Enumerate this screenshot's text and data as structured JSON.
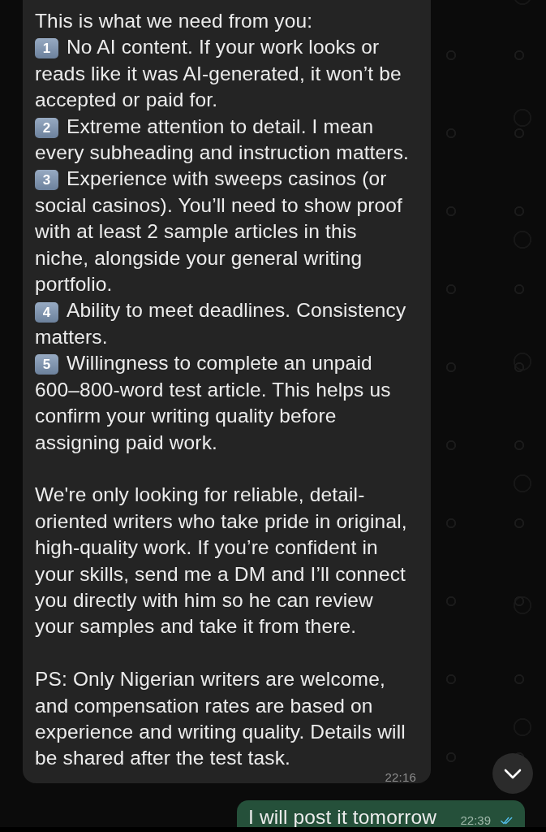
{
  "incoming_message": {
    "intro": "This is what we need from you:",
    "points": [
      {
        "number": "1",
        "lines": [
          "No AI content. If your work looks or",
          "reads like it was AI-generated, it won’t be",
          "accepted or paid for."
        ]
      },
      {
        "number": "2",
        "lines": [
          "Extreme attention to detail. I mean",
          "every subheading and instruction matters."
        ]
      },
      {
        "number": "3",
        "lines": [
          "Experience with sweeps casinos (or",
          "social casinos). You’ll need to show proof",
          "with at least 2 sample articles in this",
          "niche, alongside your general writing",
          "portfolio."
        ]
      },
      {
        "number": "4",
        "lines": [
          "Ability to meet deadlines. Consistency",
          "matters."
        ]
      },
      {
        "number": "5",
        "lines": [
          "Willingness to complete an unpaid",
          "600–800-word test article. This helps us",
          "confirm your writing quality before",
          "assigning paid work."
        ]
      }
    ],
    "paragraphs": [
      {
        "lines": [
          "We're only looking for reliable, detail-",
          "oriented writers who take pride in original,",
          "high-quality work. If you’re confident in",
          "your skills, send me a DM and I’ll connect",
          "you directly with him so he can review",
          "your samples and take it from there."
        ]
      },
      {
        "lines": [
          "PS: Only Nigerian writers are welcome,",
          "and compensation rates are based on",
          "experience and writing quality. Details will",
          "be shared after the test task."
        ]
      }
    ],
    "time": "22:16"
  },
  "outgoing_message": {
    "text": "I will post it tomorrow",
    "time": "22:39",
    "read": true
  }
}
